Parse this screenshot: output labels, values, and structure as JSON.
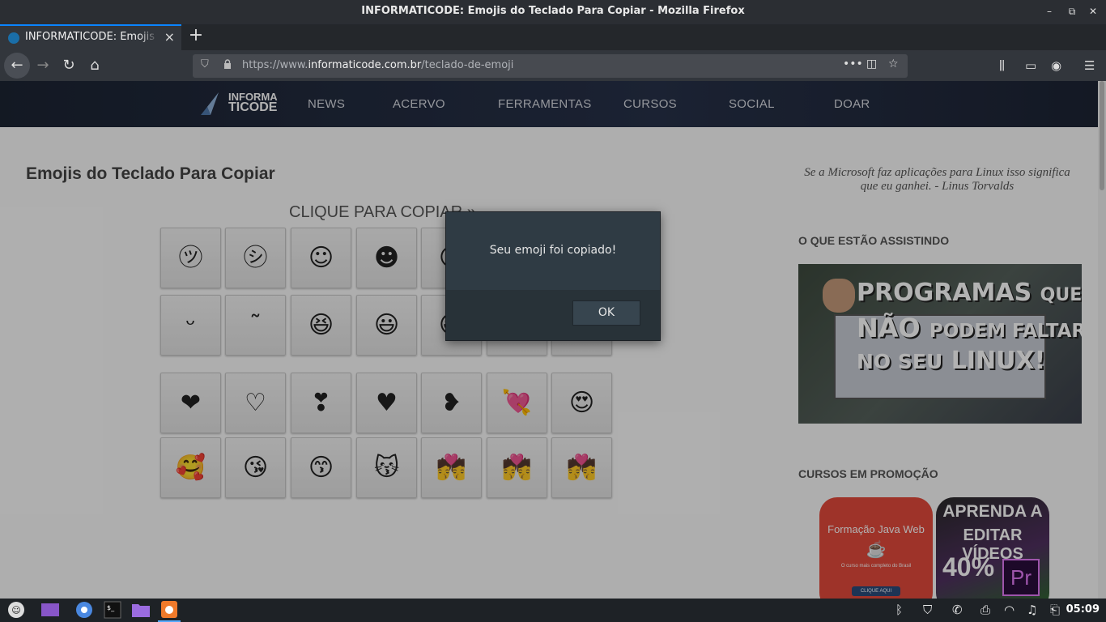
{
  "window": {
    "title": "INFORMATICODE: Emojis do Teclado Para Copiar - Mozilla Firefox",
    "minimize_icon": "minimize-icon",
    "maximize_icon": "maximize-icon",
    "close_icon": "close-icon"
  },
  "tabs": [
    {
      "label": "INFORMATICODE: Emojis do Teclado Para Copiar",
      "active": true
    }
  ],
  "tab_close": "×",
  "newtab": "+",
  "nav": {
    "back": "←",
    "forward": "→",
    "reload": "↻",
    "home": "⌂"
  },
  "urlbar": {
    "prefix": "https://www.",
    "domain": "informaticode.com.br",
    "path": "/teclado-de-emoji",
    "more": "•••",
    "pocket": "◫",
    "star": "☆"
  },
  "toolbar": {
    "library": "⫼",
    "sidebar": "▭",
    "account": "◉",
    "menu": "☰"
  },
  "site": {
    "logo": {
      "line1": "INFORMA",
      "line2": "TICODE"
    },
    "menu": [
      "NEWS",
      "ACERVO",
      "FERRAMENTAS",
      "CURSOS",
      "SOCIAL",
      "DOAR"
    ],
    "page_title": "Emojis do Teclado Para Copiar",
    "clique": "CLIQUE PARA COPIAR »",
    "emoji_rows": [
      [
        "㋡",
        "㋛",
        "☺",
        "☻",
        "☹",
        "☹",
        "☹"
      ],
      [
        "ᵕ",
        "˜",
        "😆",
        "😃",
        "😄",
        "😄",
        "😄"
      ],
      [
        "❤",
        "♡",
        "❣",
        "♥",
        "❥",
        "💘",
        "😍"
      ],
      [
        "🥰",
        "😘",
        "😙",
        "😽",
        "💏",
        "💏",
        "💏"
      ]
    ],
    "quote": "Se a Microsoft faz aplicações para Linux isso significa que eu ganhei. - Linus Torvalds",
    "watching_heading": "O QUE ESTÃO ASSISTINDO",
    "video": {
      "line1a": "PROGRAMAS",
      "line1b": "QUE",
      "line2a": "NÃO",
      "line2b": "PODEM FALTAR",
      "line3a": "NO SEU",
      "line3b": "LINUX!"
    },
    "promo_heading": "CURSOS EM PROMOÇÃO",
    "promo1": {
      "title": "Formação Java Web",
      "sub": "O curso mais completo do Brasil",
      "button": "CLIQUE AQUI"
    },
    "promo2": {
      "line1": "APRENDA A",
      "line2": "EDITAR VÍDEOS",
      "discount": "40%",
      "badge": "Pr"
    }
  },
  "dialog": {
    "message": "Seu emoji foi copiado!",
    "ok": "OK"
  },
  "taskbar": {
    "apps": [
      "launcher-icon",
      "files-icon",
      "chromium-icon",
      "terminal-icon",
      "folder-icon",
      "firefox-icon"
    ],
    "tray": [
      "bluetooth-icon",
      "shield-icon",
      "whatsapp-icon",
      "printer-icon",
      "wifi-icon",
      "music-icon",
      "clipboard-icon"
    ],
    "clock": "05:09"
  },
  "colors": {
    "accent": "#0a84ff",
    "nav_bg": "#1c2433",
    "dialog_bg": "#2f3b44"
  }
}
